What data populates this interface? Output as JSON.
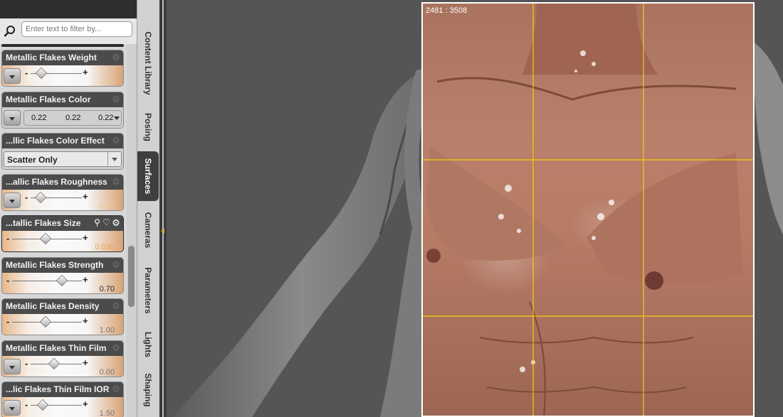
{
  "filter": {
    "placeholder": "Enter text to filter by..."
  },
  "properties": [
    {
      "label": "Metallic Flakes Weight",
      "value": "0.20",
      "slider_level": 0.2
    },
    {
      "label": "Metallic Flakes Color",
      "rgb": [
        "0.22",
        "0.22",
        "0.22"
      ]
    },
    {
      "label": "...llic Flakes Color Effect",
      "option": "Scatter Only"
    },
    {
      "label": "...allic Flakes Roughness",
      "value": "0.18",
      "slider_level": 0.18
    },
    {
      "label": "...tallic Flakes Size",
      "value": "0.030",
      "slider_level": 0.47,
      "selected": true
    },
    {
      "label": "Metallic Flakes Strength",
      "value": "0.70",
      "slider_level": 0.7
    },
    {
      "label": "Metallic Flakes Density",
      "value": "1.00",
      "slider_level": 0.47
    },
    {
      "label": "Metallic Flakes Thin Film",
      "value": "0.00",
      "slider_level": 0.45
    },
    {
      "label": "...lic Flakes Thin Film IOR",
      "value": "1.50",
      "slider_level": 0.22
    }
  ],
  "tabs": [
    {
      "label": "Content Library",
      "active": false
    },
    {
      "label": "Posing",
      "active": false
    },
    {
      "label": "Surfaces",
      "active": true
    },
    {
      "label": "Cameras",
      "active": false
    },
    {
      "label": "Parameters",
      "active": false
    },
    {
      "label": "Lights",
      "active": false
    },
    {
      "label": "Shaping",
      "active": false
    }
  ],
  "viewport": {
    "render_size": "2481 : 3508"
  },
  "colors": {
    "accent": "#e9a24a",
    "panel": "#d7d7d7",
    "viewport_bg": "#555555",
    "grid": "#ffd700"
  },
  "icons": [
    "search-icon",
    "gear-icon",
    "chevron-down-icon",
    "link-icon",
    "heart-icon"
  ]
}
